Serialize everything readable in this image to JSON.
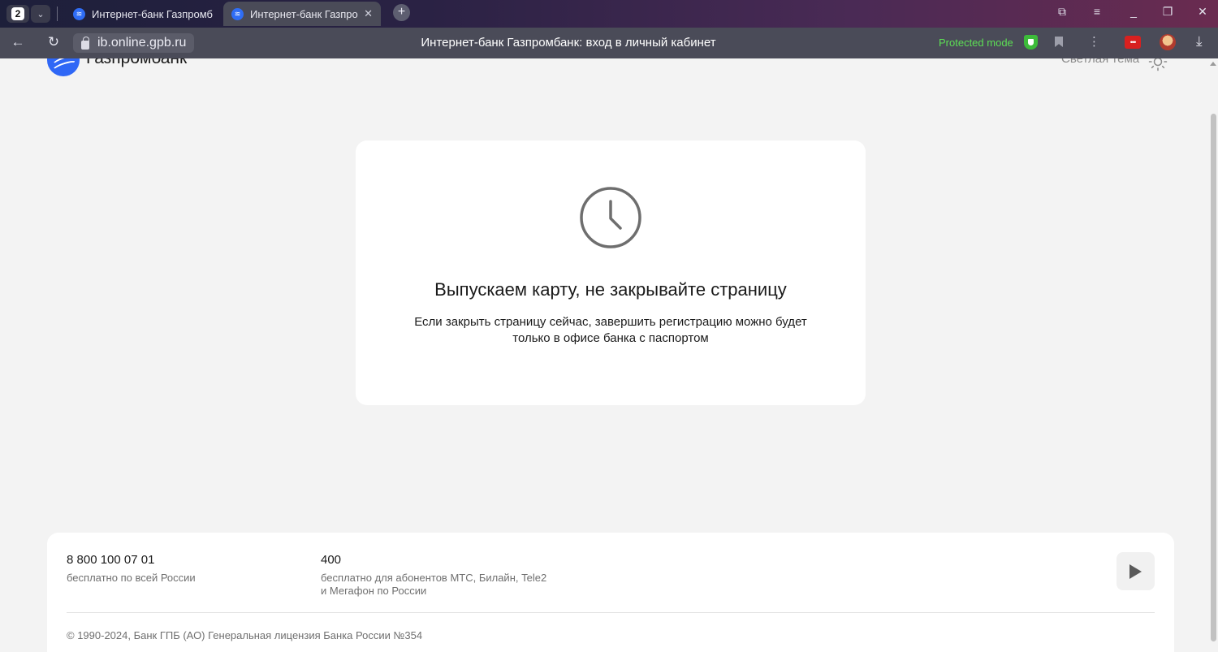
{
  "browser": {
    "tab_count": "2",
    "tabs": [
      {
        "title": "Интернет-банк Газпромб"
      },
      {
        "title": "Интернет-банк Газпро"
      }
    ],
    "url": "ib.online.gpb.ru",
    "page_title": "Интернет-банк Газпромбанк: вход в личный кабинет",
    "protected_mode": "Protected mode",
    "colors": {
      "protected": "#5ddf55",
      "accent": "#2f67f6"
    }
  },
  "header": {
    "logo_text": "Газпромбанк",
    "theme_label": "Светлая тема"
  },
  "card": {
    "icon": "clock-icon",
    "title": "Выпускаем карту, не закрывайте страницу",
    "text_line1": "Если закрыть страницу сейчас, завершить регистрацию можно будет",
    "text_line2": "только в офисе банка с паспортом"
  },
  "footer": {
    "phone1": "8 800 100 07 01",
    "phone1_note": "бесплатно по всей России",
    "phone2": "400",
    "phone2_note_line1": "бесплатно для абонентов МТС, Билайн, Tele2",
    "phone2_note_line2": "и Мегафон по России",
    "copyright": "© 1990-2024, Банк ГПБ (АО) Генеральная лицензия Банка России №354"
  }
}
